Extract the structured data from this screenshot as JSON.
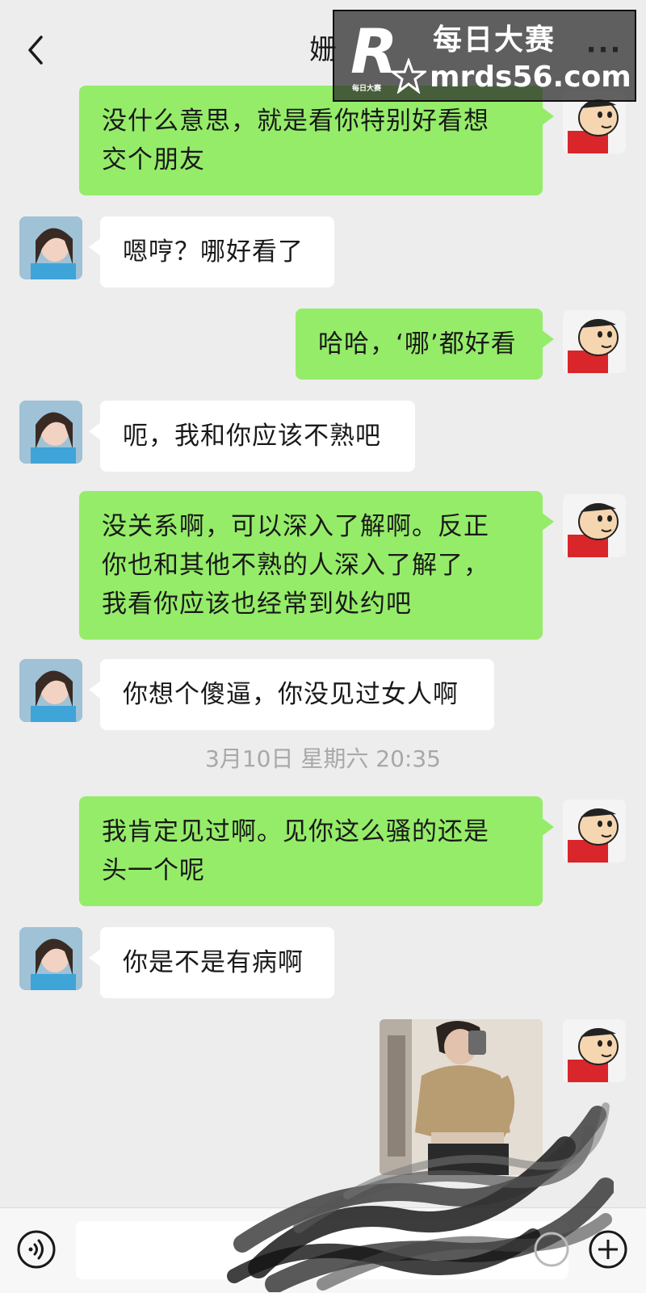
{
  "header": {
    "title": "姗",
    "back_icon": "chevron-left-icon",
    "more_icon": "more-dots-icon",
    "more_label": "···"
  },
  "watermark": {
    "logo_letter": "R",
    "logo_tag": "每日大赛",
    "name": "每日大赛",
    "domain": "mrds56.com"
  },
  "messages": [
    {
      "sender": "self",
      "text_lines": [
        "没什么意思，就是看你特别好看想",
        "交个朋友"
      ]
    },
    {
      "sender": "other",
      "text_lines": [
        "嗯哼？哪好看了"
      ]
    },
    {
      "sender": "self",
      "text_lines": [
        "哈哈，‘哪’都好看"
      ]
    },
    {
      "sender": "other",
      "text_lines": [
        "呃，我和你应该不熟吧"
      ]
    },
    {
      "sender": "self",
      "text_lines": [
        "没关系啊，可以深入了解啊。反正",
        "你也和其他不熟的人深入了解了，",
        "我看你应该也经常到处约吧"
      ]
    },
    {
      "sender": "other",
      "text_lines": [
        "你想个傻逼，你没见过女人啊"
      ]
    },
    {
      "sender": "self",
      "text_lines": [
        "我肯定见过啊。见你这么骚的还是",
        "头一个呢"
      ]
    },
    {
      "sender": "other",
      "text_lines": [
        "你是不是有病啊"
      ]
    }
  ],
  "timestamp": "3月10日 星期六 20:35",
  "photo_message": {
    "sender": "self",
    "icon": "photo-message"
  },
  "input_bar": {
    "voice_icon": "voice-icon",
    "emoji_icon": "emoji-icon",
    "plus_icon": "plus-icon",
    "input_value": ""
  },
  "colors": {
    "background": "#ededed",
    "self_bubble": "#95ec69",
    "other_bubble": "#ffffff",
    "timestamp_text": "#a8a8a8"
  }
}
